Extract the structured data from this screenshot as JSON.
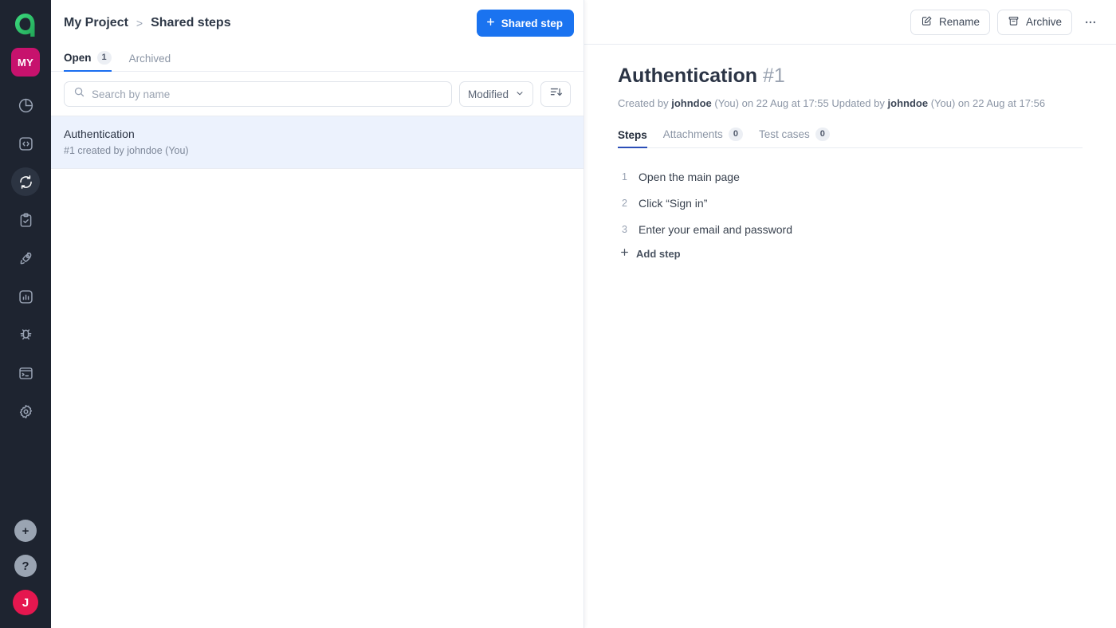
{
  "rail": {
    "logo_icon": "app-logo-a",
    "workspace_initials": "MY",
    "nav": [
      {
        "icon": "pie-chart-icon",
        "name": "dashboard",
        "active": false
      },
      {
        "icon": "code-brackets-icon",
        "name": "code",
        "active": false
      },
      {
        "icon": "sync-arrows-icon",
        "name": "shared-steps",
        "active": true
      },
      {
        "icon": "clipboard-check-icon",
        "name": "test-runs",
        "active": false
      },
      {
        "icon": "rocket-icon",
        "name": "releases",
        "active": false
      },
      {
        "icon": "bar-chart-icon",
        "name": "reports",
        "active": false
      },
      {
        "icon": "bug-icon",
        "name": "defects",
        "active": false
      },
      {
        "icon": "terminal-icon",
        "name": "terminal",
        "active": false
      },
      {
        "icon": "gear-icon",
        "name": "settings",
        "active": false
      }
    ],
    "bottom": [
      {
        "icon": "plus-circle-icon",
        "name": "create",
        "glyph": "+"
      },
      {
        "icon": "question-circle-icon",
        "name": "help",
        "glyph": "?"
      }
    ],
    "user_initial": "J"
  },
  "list_panel": {
    "breadcrumb": {
      "project": "My Project",
      "separator": ">",
      "current": "Shared steps"
    },
    "primary_button": {
      "label": "Shared step",
      "icon": "plus-icon",
      "color": "#1a73f0"
    },
    "tabs": [
      {
        "label": "Open",
        "count": "1",
        "active": true
      },
      {
        "label": "Archived",
        "count": null,
        "active": false
      }
    ],
    "search": {
      "placeholder": "Search by name",
      "value": "",
      "icon": "search-icon"
    },
    "sort": {
      "selected": "Modified",
      "chevron_icon": "chevron-down-icon",
      "direction_icon": "sort-descending-icon"
    },
    "items": [
      {
        "title": "Authentication",
        "subtitle": "#1 created by johndoe (You)",
        "selected": true
      }
    ]
  },
  "detail": {
    "actions": [
      {
        "label": "Rename",
        "icon": "pencil-square-icon"
      },
      {
        "label": "Archive",
        "icon": "archive-box-icon"
      }
    ],
    "more_icon": "ellipsis-horizontal-icon",
    "title": "Authentication",
    "title_number": "#1",
    "meta": {
      "created_prefix": "Created by",
      "created_user": "johndoe",
      "created_suffix": "(You) on 22 Aug at 17:55",
      "updated_prefix": "Updated by",
      "updated_user": "johndoe",
      "updated_suffix": "(You) on 22 Aug at 17:56"
    },
    "tabs": [
      {
        "label": "Steps",
        "count": null,
        "active": true
      },
      {
        "label": "Attachments",
        "count": "0",
        "active": false
      },
      {
        "label": "Test cases",
        "count": "0",
        "active": false
      }
    ],
    "steps": [
      {
        "n": "1",
        "text": "Open the main page"
      },
      {
        "n": "2",
        "text": "Click “Sign in”"
      },
      {
        "n": "3",
        "text": "Enter your email and password"
      }
    ],
    "add_step": {
      "label": "Add step",
      "icon": "plus-icon"
    }
  }
}
